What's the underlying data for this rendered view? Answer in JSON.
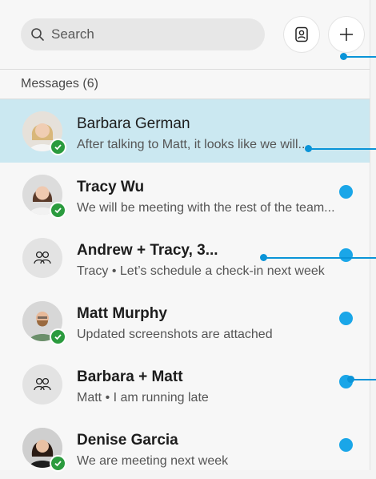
{
  "search": {
    "placeholder": "Search"
  },
  "header": {
    "contacts_icon": "contacts-icon",
    "add_icon": "plus-icon"
  },
  "section": {
    "title": "Messages (6)"
  },
  "colors": {
    "unread": "#1aa6e8",
    "selected_row": "#cbe8f1",
    "presence": "#2b9b3e",
    "callout": "#0a94d8"
  },
  "conversations": [
    {
      "name": "Barbara German",
      "preview": "After talking to Matt, it looks like we will...",
      "type": "person",
      "presence": "available",
      "unread": false,
      "selected": true
    },
    {
      "name": "Tracy Wu",
      "preview": "We will be meeting with the rest of the team...",
      "type": "person",
      "presence": "available",
      "unread": true,
      "selected": false
    },
    {
      "name": "Andrew + Tracy, 3...",
      "preview": "Tracy • Let’s schedule a check-in next week",
      "type": "group",
      "unread": true,
      "selected": false
    },
    {
      "name": "Matt Murphy",
      "preview": "Updated screenshots are attached",
      "type": "person",
      "presence": "available",
      "unread": true,
      "selected": false
    },
    {
      "name": "Barbara + Matt",
      "preview": "Matt • I am running late",
      "type": "group",
      "unread": true,
      "selected": false
    },
    {
      "name": "Denise Garcia",
      "preview": "We are meeting next week",
      "type": "person",
      "presence": "available",
      "unread": true,
      "selected": false
    }
  ]
}
